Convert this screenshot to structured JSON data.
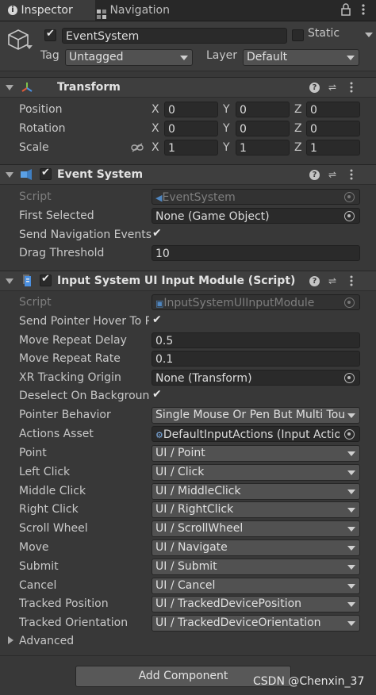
{
  "tabs": [
    {
      "label": "Inspector",
      "icon": "info-icon"
    },
    {
      "label": "Navigation",
      "icon": "navigation-icon"
    }
  ],
  "gameobject": {
    "name": "EventSystem",
    "active": true,
    "static_label": "Static",
    "static": false,
    "tag_label": "Tag",
    "tag_value": "Untagged",
    "layer_label": "Layer",
    "layer_value": "Default"
  },
  "transform": {
    "title": "Transform",
    "rows": [
      {
        "label": "Position",
        "x": "0",
        "y": "0",
        "z": "0"
      },
      {
        "label": "Rotation",
        "x": "0",
        "y": "0",
        "z": "0"
      },
      {
        "label": "Scale",
        "x": "1",
        "y": "1",
        "z": "1"
      }
    ],
    "axis": {
      "x": "X",
      "y": "Y",
      "z": "Z"
    }
  },
  "event_system": {
    "title": "Event System",
    "enabled": true,
    "script_label": "Script",
    "script_value": "EventSystem",
    "first_selected_label": "First Selected",
    "first_selected_value": "None (Game Object)",
    "send_nav_label": "Send Navigation Events",
    "send_nav_checked": true,
    "drag_threshold_label": "Drag Threshold",
    "drag_threshold_value": "10"
  },
  "input_module": {
    "title": "Input System UI Input Module (Script)",
    "enabled": true,
    "script_label": "Script",
    "script_value": "InputSystemUIInputModule",
    "send_pointer_hover_label": "Send Pointer Hover To P",
    "send_pointer_hover_checked": true,
    "move_repeat_delay_label": "Move Repeat Delay",
    "move_repeat_delay_value": "0.5",
    "move_repeat_rate_label": "Move Repeat Rate",
    "move_repeat_rate_value": "0.1",
    "xr_origin_label": "XR Tracking Origin",
    "xr_origin_value": "None (Transform)",
    "deselect_label": "Deselect On Backgrounc",
    "deselect_checked": true,
    "pointer_behavior_label": "Pointer Behavior",
    "pointer_behavior_value": "Single Mouse Or Pen But Multi Touc",
    "actions_asset_label": "Actions Asset",
    "actions_asset_value": "DefaultInputActions (Input Action",
    "actions": [
      {
        "label": "Point",
        "value": "UI / Point"
      },
      {
        "label": "Left Click",
        "value": "UI / Click"
      },
      {
        "label": "Middle Click",
        "value": "UI / MiddleClick"
      },
      {
        "label": "Right Click",
        "value": "UI / RightClick"
      },
      {
        "label": "Scroll Wheel",
        "value": "UI / ScrollWheel"
      },
      {
        "label": "Move",
        "value": "UI / Navigate"
      },
      {
        "label": "Submit",
        "value": "UI / Submit"
      },
      {
        "label": "Cancel",
        "value": "UI / Cancel"
      },
      {
        "label": "Tracked Position",
        "value": "UI / TrackedDevicePosition"
      },
      {
        "label": "Tracked Orientation",
        "value": "UI / TrackedDeviceOrientation"
      }
    ],
    "advanced_label": "Advanced"
  },
  "add_component_label": "Add Component",
  "watermark": "CSDN @Chenxin_37",
  "colors": {
    "panel": "#383838",
    "field": "#2a2a2a",
    "header": "#3e3e3e",
    "transform_icon": "#e07a2f",
    "event_icon": "#5aa0e6"
  }
}
